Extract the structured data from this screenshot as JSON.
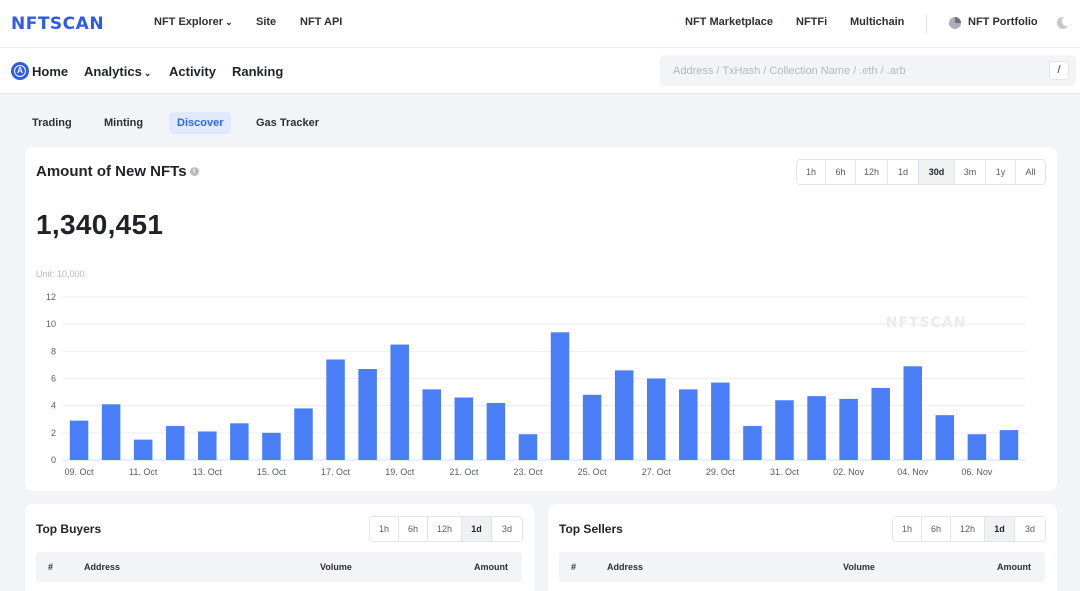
{
  "topbar": {
    "logo": "NFTSCAN",
    "nav": [
      "NFT Explorer",
      "Site",
      "NFT API"
    ],
    "right_nav": [
      "NFT Marketplace",
      "NFTFi",
      "Multichain"
    ],
    "portfolio": "NFT Portfolio",
    "icons": {
      "explorer_dropdown": "chevron-down-icon",
      "portfolio": "pie-chart-icon",
      "theme": "moon-icon"
    }
  },
  "subbar": {
    "home": "Home",
    "analytics": "Analytics",
    "activity": "Activity",
    "ranking": "Ranking",
    "search_placeholder": "Address / TxHash / Collection Name / .eth / .arb",
    "search_shortcut": "/",
    "icons": {
      "chain": "ethereum-chain-icon",
      "analytics_dropdown": "chevron-down-icon"
    }
  },
  "tabs": [
    {
      "label": "Trading",
      "active": false
    },
    {
      "label": "Minting",
      "active": false
    },
    {
      "label": "Discover",
      "active": true
    },
    {
      "label": "Gas Tracker",
      "active": false
    }
  ],
  "main": {
    "title": "Amount of New NFTs",
    "total": "1,340,451",
    "unit": "Unit: 10,000",
    "ranges": [
      "1h",
      "6h",
      "12h",
      "1d",
      "30d",
      "3m",
      "1y",
      "All"
    ],
    "active_range": "30d",
    "watermark": "NFTSCAN"
  },
  "chart_data": {
    "type": "bar",
    "ylabel": "",
    "xlabel": "",
    "ylim": [
      0,
      12
    ],
    "yticks": [
      0,
      2,
      4,
      6,
      8,
      10,
      12
    ],
    "grid": true,
    "x_tick_labels": [
      "09. Oct",
      "11. Oct",
      "13. Oct",
      "15. Oct",
      "17. Oct",
      "19. Oct",
      "21. Oct",
      "23. Oct",
      "25. Oct",
      "27. Oct",
      "29. Oct",
      "31. Oct",
      "02. Nov",
      "04. Nov",
      "06. Nov"
    ],
    "categories": [
      "09. Oct",
      "10. Oct",
      "11. Oct",
      "12. Oct",
      "13. Oct",
      "14. Oct",
      "15. Oct",
      "16. Oct",
      "17. Oct",
      "18. Oct",
      "19. Oct",
      "20. Oct",
      "21. Oct",
      "22. Oct",
      "23. Oct",
      "24. Oct",
      "25. Oct",
      "26. Oct",
      "27. Oct",
      "28. Oct",
      "29. Oct",
      "30. Oct",
      "31. Oct",
      "01. Nov",
      "02. Nov",
      "03. Nov",
      "04. Nov",
      "05. Nov",
      "06. Nov",
      "07. Nov"
    ],
    "values": [
      2.9,
      4.1,
      1.5,
      2.5,
      2.1,
      2.7,
      2.0,
      3.8,
      7.4,
      6.7,
      8.5,
      5.2,
      4.6,
      4.2,
      1.9,
      9.4,
      4.8,
      6.6,
      6.0,
      5.2,
      5.7,
      2.5,
      4.4,
      4.7,
      4.5,
      5.3,
      6.9,
      3.3,
      1.9,
      2.2
    ],
    "color": "#4a7ef7"
  },
  "buyers": {
    "title": "Top Buyers",
    "ranges": [
      "1h",
      "6h",
      "12h",
      "1d",
      "3d"
    ],
    "active_range": "1d",
    "columns": [
      "#",
      "Address",
      "Volume",
      "Amount"
    ]
  },
  "sellers": {
    "title": "Top Sellers",
    "ranges": [
      "1h",
      "6h",
      "12h",
      "1d",
      "3d"
    ],
    "active_range": "1d",
    "columns": [
      "#",
      "Address",
      "Volume",
      "Amount"
    ]
  }
}
